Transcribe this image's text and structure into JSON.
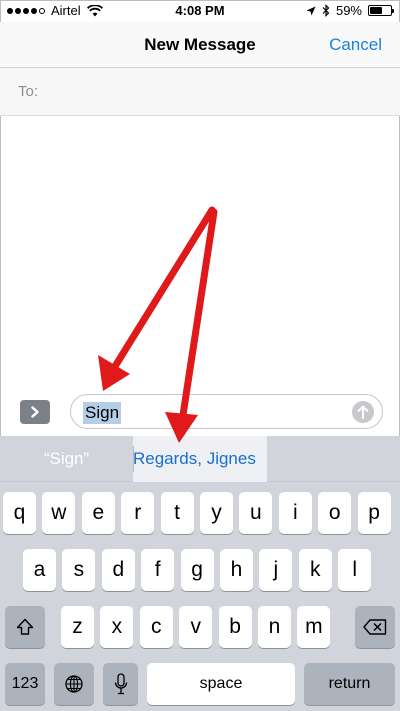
{
  "status_bar": {
    "carrier": "Airtel",
    "time": "4:08 PM",
    "battery": "59%",
    "battery_level": 0.59,
    "signal_bars": 4
  },
  "nav": {
    "title": "New Message",
    "cancel_label": "Cancel"
  },
  "to_field": {
    "label": "To:"
  },
  "compose": {
    "message_text": "Sign",
    "apps_icon": "chevron-right-icon",
    "send_icon": "arrow-up-icon"
  },
  "predictive": {
    "items": [
      "“Sign”",
      "Regards, Jignes",
      ""
    ]
  },
  "keyboard": {
    "row1": [
      "q",
      "w",
      "e",
      "r",
      "t",
      "y",
      "u",
      "i",
      "o",
      "p"
    ],
    "row2": [
      "a",
      "s",
      "d",
      "f",
      "g",
      "h",
      "j",
      "k",
      "l"
    ],
    "row3": [
      "z",
      "x",
      "c",
      "v",
      "b",
      "n",
      "m"
    ],
    "numbers_key": "123",
    "space_key": "space",
    "return_key": "return",
    "shift_icon": "shift-icon",
    "delete_icon": "backspace-icon",
    "globe_icon": "globe-icon",
    "mic_icon": "microphone-icon"
  },
  "annotation": {
    "arrow_color": "#e0191b"
  }
}
